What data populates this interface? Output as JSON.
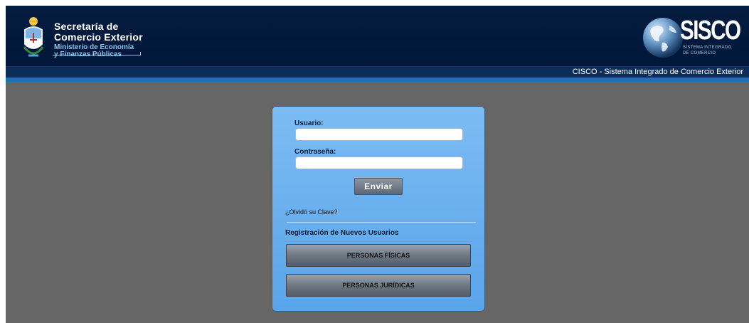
{
  "header": {
    "logo": {
      "line1": "Secretaría de",
      "line2": "Comercio Exterior",
      "line3": "Ministerio de Economía",
      "line4": "y Finanzas Públicas"
    },
    "sisco": {
      "word": "SISCO",
      "sub1": "SISTEMA INTEGRADO",
      "sub2": "DE COMERCIO"
    },
    "subtitle": "CISCO - Sistema Integrado de Comercio Exterior"
  },
  "login": {
    "usuario_label": "Usuario:",
    "usuario_value": "",
    "password_label": "Contraseña:",
    "password_value": "",
    "submit_label": "Enviar",
    "forgot_link": "¿Olvidó su Clave?",
    "registration_title": "Registración de Nuevos Usuarios",
    "fisicas_label": "PERSONAS FÍSICAS",
    "juridicas_label": "PERSONAS JURÍDICAS"
  },
  "colors": {
    "header_bg": "#041c3f",
    "stripe": "#1a73b6",
    "page_bg": "#666666",
    "login_box": "#6fb2f0"
  }
}
